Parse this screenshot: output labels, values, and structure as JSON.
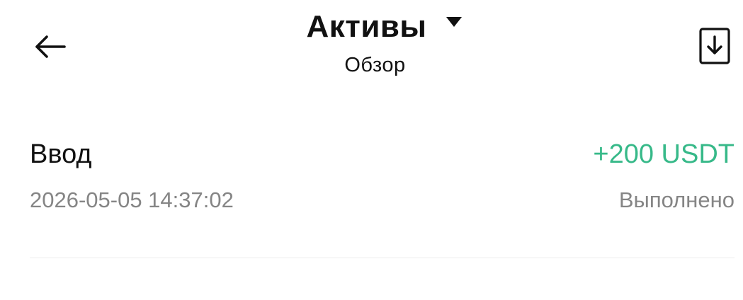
{
  "header": {
    "back_icon": "arrow-left-icon",
    "title": "Активы",
    "dropdown_icon": "caret-down-icon",
    "subtitle": "Обзор",
    "download_icon": "download-icon"
  },
  "transactions": [
    {
      "type": "Ввод",
      "amount": "+200 USDT",
      "datetime": "2026-05-05 14:37:02",
      "status": "Выполнено"
    }
  ],
  "colors": {
    "amount_positive": "#37b989",
    "secondary_text": "#858585",
    "primary_text": "#111111",
    "divider": "#ececec"
  }
}
